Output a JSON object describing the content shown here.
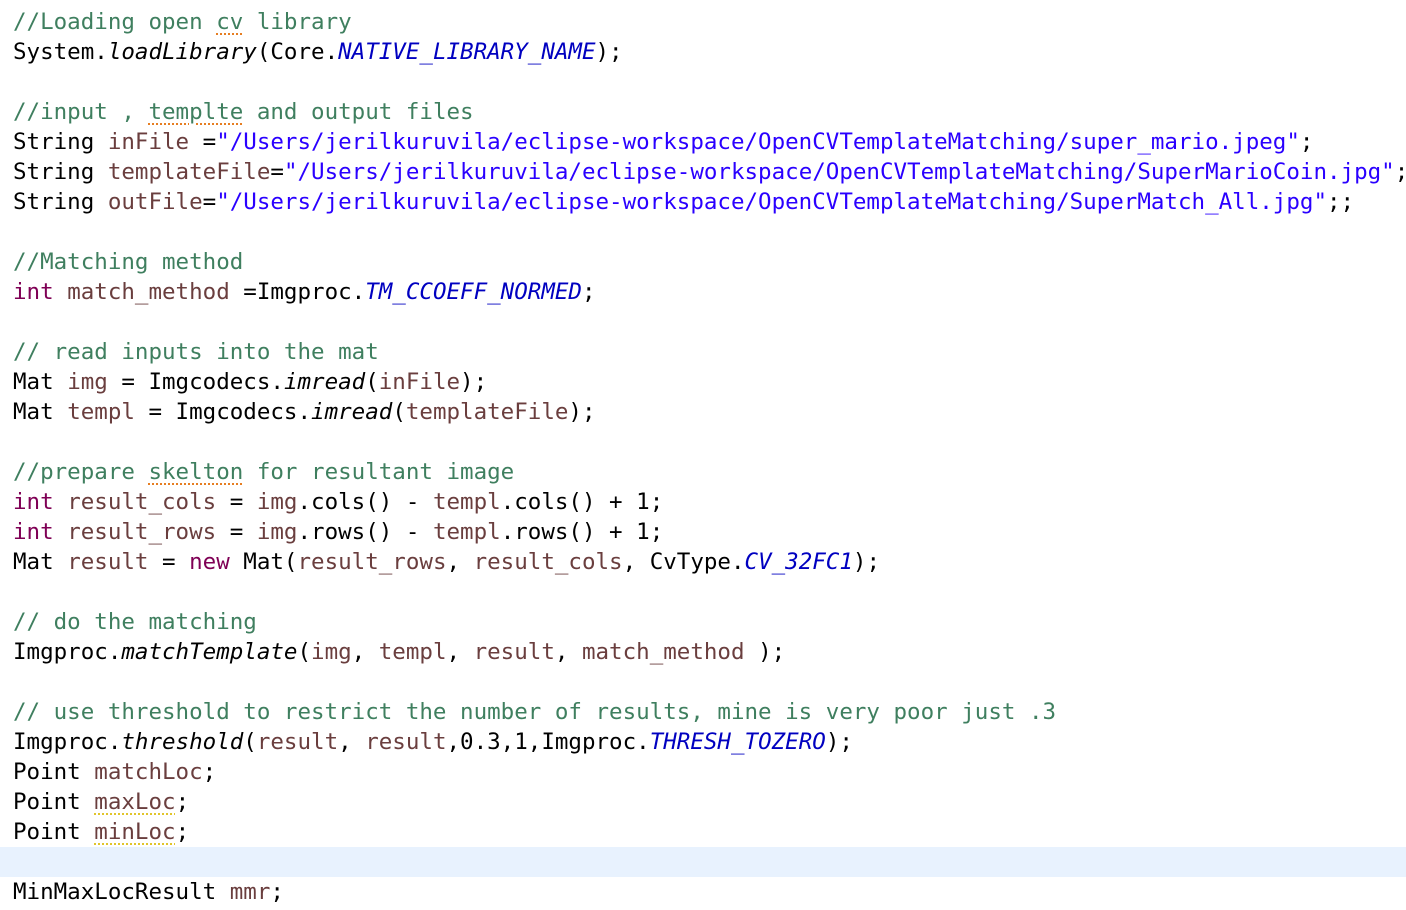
{
  "editor": {
    "language": "java",
    "highlighted_line_index": 28,
    "colors": {
      "comment": "#3f7f5f",
      "keyword": "#7f0055",
      "local_variable": "#6a3e3e",
      "string": "#2a00ff",
      "constant": "#0000c0",
      "plain": "#000000",
      "current_line_bg": "#e8f2fe",
      "spelling_underline": "#e67e22",
      "warning_underline": "#e1c52c"
    },
    "lines": [
      [
        [
          "cm",
          "//Loading open "
        ],
        [
          "cm",
          "cv",
          "spell"
        ],
        [
          "cm",
          " library"
        ]
      ],
      [
        [
          "id",
          "System."
        ],
        [
          "method",
          "loadLibrary"
        ],
        [
          "id",
          "(Core."
        ],
        [
          "const",
          "NATIVE_LIBRARY_NAME"
        ],
        [
          "id",
          ");"
        ]
      ],
      [],
      [
        [
          "cm",
          "//input , "
        ],
        [
          "cm",
          "templte",
          "spell"
        ],
        [
          "cm",
          " and output files"
        ]
      ],
      [
        [
          "id",
          "String "
        ],
        [
          "var",
          "inFile"
        ],
        [
          "id",
          " ="
        ],
        [
          "str",
          "\"/Users/jerilkuruvila/eclipse-workspace/OpenCVTemplateMatching/super_mario.jpeg\""
        ],
        [
          "id",
          ";"
        ]
      ],
      [
        [
          "id",
          "String "
        ],
        [
          "var",
          "templateFile"
        ],
        [
          "id",
          "="
        ],
        [
          "str",
          "\"/Users/jerilkuruvila/eclipse-workspace/OpenCVTemplateMatching/SuperMarioCoin.jpg\""
        ],
        [
          "id",
          ";"
        ]
      ],
      [
        [
          "id",
          "String "
        ],
        [
          "var",
          "outFile"
        ],
        [
          "id",
          "="
        ],
        [
          "str",
          "\"/Users/jerilkuruvila/eclipse-workspace/OpenCVTemplateMatching/SuperMatch_All.jpg\""
        ],
        [
          "id",
          ";;"
        ]
      ],
      [],
      [
        [
          "cm",
          "//Matching method"
        ]
      ],
      [
        [
          "kw",
          "int"
        ],
        [
          "sp",
          " "
        ],
        [
          "var",
          "match_method"
        ],
        [
          "id",
          " =Imgproc."
        ],
        [
          "const",
          "TM_CCOEFF_NORMED"
        ],
        [
          "id",
          ";"
        ]
      ],
      [],
      [
        [
          "cm",
          "// read inputs into the mat"
        ]
      ],
      [
        [
          "id",
          "Mat "
        ],
        [
          "var",
          "img"
        ],
        [
          "id",
          " = Imgcodecs."
        ],
        [
          "method",
          "imread"
        ],
        [
          "id",
          "("
        ],
        [
          "var",
          "inFile"
        ],
        [
          "id",
          ");"
        ]
      ],
      [
        [
          "id",
          "Mat "
        ],
        [
          "var",
          "templ"
        ],
        [
          "id",
          " = Imgcodecs."
        ],
        [
          "method",
          "imread"
        ],
        [
          "id",
          "("
        ],
        [
          "var",
          "templateFile"
        ],
        [
          "id",
          ");"
        ]
      ],
      [],
      [
        [
          "cm",
          "//prepare "
        ],
        [
          "cm",
          "skelton",
          "spell"
        ],
        [
          "cm",
          " for resultant image"
        ]
      ],
      [
        [
          "kw",
          "int"
        ],
        [
          "sp",
          " "
        ],
        [
          "var",
          "result_cols"
        ],
        [
          "id",
          " = "
        ],
        [
          "var",
          "img"
        ],
        [
          "id",
          ".cols() - "
        ],
        [
          "var",
          "templ"
        ],
        [
          "id",
          ".cols() + 1;"
        ]
      ],
      [
        [
          "kw",
          "int"
        ],
        [
          "sp",
          " "
        ],
        [
          "var",
          "result_rows"
        ],
        [
          "id",
          " = "
        ],
        [
          "var",
          "img"
        ],
        [
          "id",
          ".rows() - "
        ],
        [
          "var",
          "templ"
        ],
        [
          "id",
          ".rows() + 1;"
        ]
      ],
      [
        [
          "id",
          "Mat "
        ],
        [
          "var",
          "result"
        ],
        [
          "id",
          " = "
        ],
        [
          "kw",
          "new"
        ],
        [
          "id",
          " Mat("
        ],
        [
          "var",
          "result_rows"
        ],
        [
          "id",
          ", "
        ],
        [
          "var",
          "result_cols"
        ],
        [
          "id",
          ", CvType."
        ],
        [
          "const",
          "CV_32FC1"
        ],
        [
          "id",
          ");"
        ]
      ],
      [],
      [
        [
          "cm",
          "// do the matching"
        ]
      ],
      [
        [
          "id",
          "Imgproc."
        ],
        [
          "method",
          "matchTemplate"
        ],
        [
          "id",
          "("
        ],
        [
          "var",
          "img"
        ],
        [
          "id",
          ", "
        ],
        [
          "var",
          "templ"
        ],
        [
          "id",
          ", "
        ],
        [
          "var",
          "result"
        ],
        [
          "id",
          ", "
        ],
        [
          "var",
          "match_method"
        ],
        [
          "id",
          " );"
        ]
      ],
      [],
      [
        [
          "cm",
          "// use threshold to restrict the number of results, mine is very poor just .3"
        ]
      ],
      [
        [
          "id",
          "Imgproc."
        ],
        [
          "method",
          "threshold"
        ],
        [
          "id",
          "("
        ],
        [
          "var",
          "result"
        ],
        [
          "id",
          ", "
        ],
        [
          "var",
          "result"
        ],
        [
          "id",
          ",0.3,1,Imgproc."
        ],
        [
          "const",
          "THRESH_TOZERO"
        ],
        [
          "id",
          ");"
        ]
      ],
      [
        [
          "id",
          "Point "
        ],
        [
          "var",
          "matchLoc"
        ],
        [
          "id",
          ";"
        ]
      ],
      [
        [
          "id",
          "Point "
        ],
        [
          "var",
          "maxLoc",
          "warn"
        ],
        [
          "id",
          ";"
        ]
      ],
      [
        [
          "id",
          "Point "
        ],
        [
          "var",
          "minLoc",
          "warn"
        ],
        [
          "id",
          ";"
        ]
      ],
      [],
      [
        [
          "id",
          "MinMaxLocResult "
        ],
        [
          "var",
          "mmr"
        ],
        [
          "id",
          ";"
        ]
      ]
    ]
  }
}
